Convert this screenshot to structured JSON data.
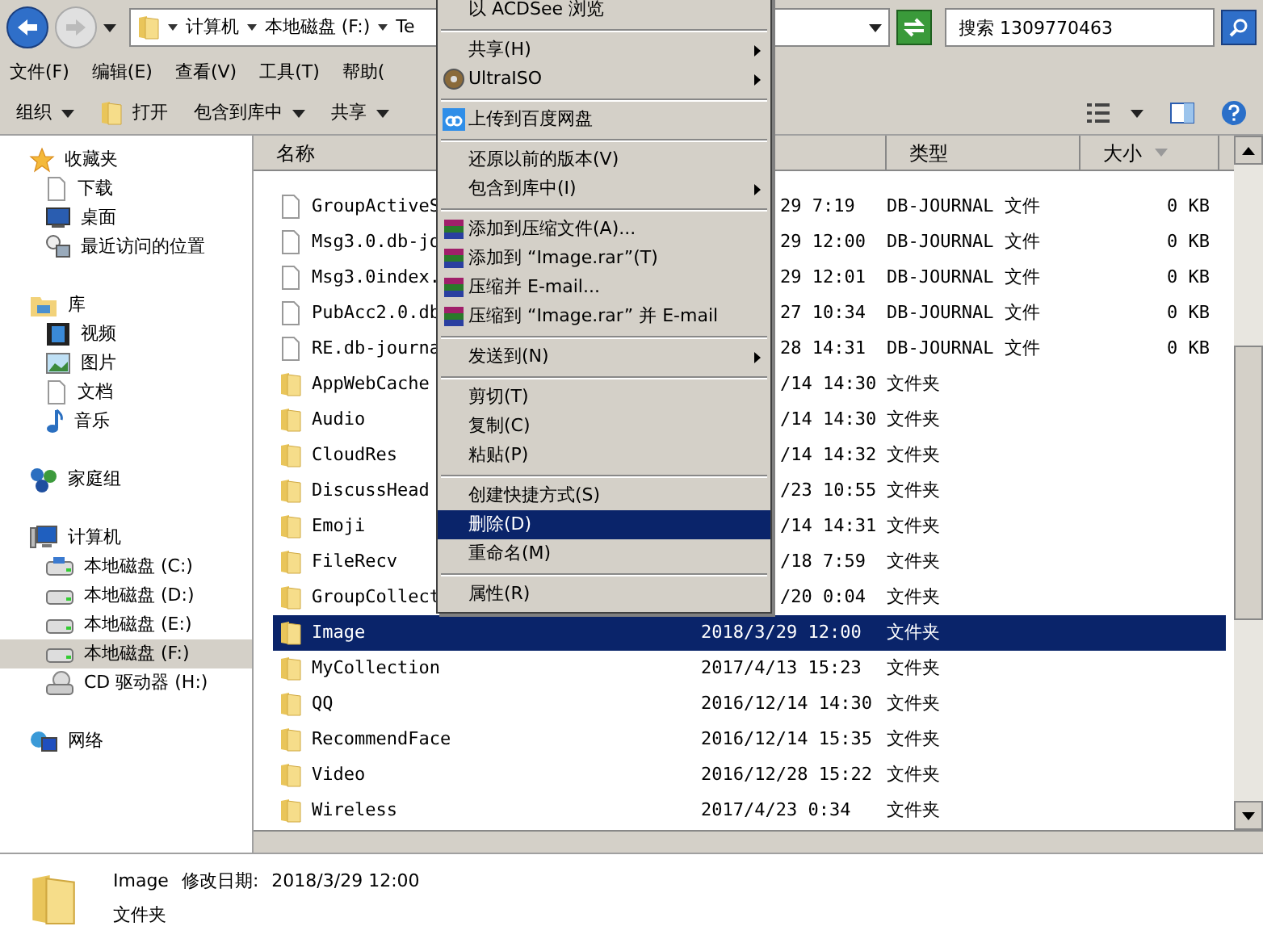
{
  "nav": {
    "address": [
      {
        "label": "计算机"
      },
      {
        "label": "本地磁盘 (F:)"
      },
      {
        "label": "Te"
      }
    ],
    "search": {
      "placeholder": "搜索 1309770463"
    }
  },
  "menu_bar": [
    "文件(F)",
    "编辑(E)",
    "查看(V)",
    "工具(T)",
    "帮助("
  ],
  "toolbar": [
    {
      "label": "组织",
      "kind": "plain",
      "dropdown": true
    },
    {
      "label": "打开",
      "kind": "icon",
      "dropdown": false
    },
    {
      "label": "包含到库中",
      "kind": "plain",
      "dropdown": true
    },
    {
      "label": "共享",
      "kind": "plain",
      "dropdown": true
    }
  ],
  "sidebar": [
    {
      "label": "收藏夹",
      "kind": "favorites",
      "selected": false,
      "children": [
        {
          "label": "下载",
          "kind": "download",
          "selected": false
        },
        {
          "label": "桌面",
          "kind": "desktop",
          "selected": false
        },
        {
          "label": "最近访问的位置",
          "kind": "recent",
          "selected": false
        }
      ]
    },
    {
      "label": "库",
      "kind": "library",
      "selected": false,
      "children": [
        {
          "label": "视频",
          "kind": "video",
          "selected": false
        },
        {
          "label": "图片",
          "kind": "pictures",
          "selected": false
        },
        {
          "label": "文档",
          "kind": "documents",
          "selected": false
        },
        {
          "label": "音乐",
          "kind": "music",
          "selected": false
        }
      ]
    },
    {
      "label": "家庭组",
      "kind": "homegroup",
      "selected": false
    },
    {
      "label": "计算机",
      "kind": "computer",
      "selected": false,
      "children": [
        {
          "label": "本地磁盘 (C:)",
          "kind": "system_drive",
          "selected": false
        },
        {
          "label": "本地磁盘 (D:)",
          "kind": "drive",
          "selected": false
        },
        {
          "label": "本地磁盘 (E:)",
          "kind": "drive",
          "selected": false
        },
        {
          "label": "本地磁盘 (F:)",
          "kind": "drive",
          "selected": true
        },
        {
          "label": "CD 驱动器 (H:)",
          "kind": "cd_drive",
          "selected": false
        }
      ]
    },
    {
      "label": "网络",
      "kind": "network",
      "selected": false
    }
  ],
  "columns": [
    {
      "label": "名称",
      "sorted": false
    },
    {
      "label": "类型",
      "sorted": false
    },
    {
      "label": "大小",
      "sorted": true
    }
  ],
  "files": [
    {
      "name": "GroupActiveS",
      "date": "29 7:19",
      "type": "DB-JOURNAL 文件",
      "size": "0 KB",
      "kind": "file",
      "selected": false
    },
    {
      "name": "Msg3.0.db-jo",
      "date": "29 12:00",
      "type": "DB-JOURNAL 文件",
      "size": "0 KB",
      "kind": "file",
      "selected": false
    },
    {
      "name": "Msg3.0index.",
      "date": "29 12:01",
      "type": "DB-JOURNAL 文件",
      "size": "0 KB",
      "kind": "file",
      "selected": false
    },
    {
      "name": "PubAcc2.0.db",
      "date": "27 10:34",
      "type": "DB-JOURNAL 文件",
      "size": "0 KB",
      "kind": "file",
      "selected": false
    },
    {
      "name": "RE.db-journa",
      "date": "28 14:31",
      "type": "DB-JOURNAL 文件",
      "size": "0 KB",
      "kind": "file",
      "selected": false
    },
    {
      "name": "AppWebCache",
      "date": "/14 14:30",
      "type": "文件夹",
      "kind": "folder",
      "selected": false
    },
    {
      "name": "Audio",
      "date": "/14 14:30",
      "type": "文件夹",
      "kind": "folder",
      "selected": false
    },
    {
      "name": "CloudRes",
      "date": "/14 14:32",
      "type": "文件夹",
      "kind": "folder",
      "selected": false
    },
    {
      "name": "DiscussHead",
      "date": "/23 10:55",
      "type": "文件夹",
      "kind": "folder",
      "selected": false
    },
    {
      "name": "Emoji",
      "date": "/14 14:31",
      "type": "文件夹",
      "kind": "folder",
      "selected": false
    },
    {
      "name": "FileRecv",
      "date": "/18 7:59",
      "type": "文件夹",
      "kind": "folder",
      "selected": false
    },
    {
      "name": "GroupCollect",
      "date": "/20 0:04",
      "type": "文件夹",
      "kind": "folder",
      "selected": false
    },
    {
      "name": "Image",
      "date": "2018/3/29 12:00",
      "type": "文件夹",
      "kind": "folder",
      "selected": true
    },
    {
      "name": "MyCollection",
      "date": "2017/4/13 15:23",
      "type": "文件夹",
      "kind": "folder",
      "selected": false
    },
    {
      "name": "QQ",
      "date": "2016/12/14 14:30",
      "type": "文件夹",
      "kind": "folder",
      "selected": false
    },
    {
      "name": "RecommendFace",
      "date": "2016/12/14 15:35",
      "type": "文件夹",
      "kind": "folder",
      "selected": false
    },
    {
      "name": "Video",
      "date": "2016/12/28 15:22",
      "type": "文件夹",
      "kind": "folder",
      "selected": false
    },
    {
      "name": "Wireless",
      "date": "2017/4/23 0:34",
      "type": "文件夹",
      "kind": "folder",
      "selected": false
    }
  ],
  "context_menu": [
    [
      {
        "label": "以 ACDSee 浏览",
        "kind": "plain",
        "submenu": false,
        "selected": false
      }
    ],
    [
      {
        "label": "共享(H)",
        "kind": "plain",
        "submenu": true,
        "selected": false
      },
      {
        "label": "UltraISO",
        "kind": "disc",
        "submenu": true,
        "selected": false
      }
    ],
    [
      {
        "label": "上传到百度网盘",
        "kind": "cloud",
        "submenu": false,
        "selected": false
      }
    ],
    [
      {
        "label": "还原以前的版本(V)",
        "kind": "plain",
        "submenu": false,
        "selected": false
      },
      {
        "label": "包含到库中(I)",
        "kind": "plain",
        "submenu": true,
        "selected": false
      }
    ],
    [
      {
        "label": "添加到压缩文件(A)...",
        "kind": "archive",
        "submenu": false,
        "selected": false
      },
      {
        "label": "添加到 “Image.rar”(T)",
        "kind": "archive",
        "submenu": false,
        "selected": false
      },
      {
        "label": "压缩并 E-mail...",
        "kind": "archive",
        "submenu": false,
        "selected": false
      },
      {
        "label": "压缩到 “Image.rar” 并 E-mail",
        "kind": "archive",
        "submenu": false,
        "selected": false
      }
    ],
    [
      {
        "label": "发送到(N)",
        "kind": "plain",
        "submenu": true,
        "selected": false
      }
    ],
    [
      {
        "label": "剪切(T)",
        "kind": "plain",
        "submenu": false,
        "selected": false
      },
      {
        "label": "复制(C)",
        "kind": "plain",
        "submenu": false,
        "selected": false
      },
      {
        "label": "粘贴(P)",
        "kind": "plain",
        "submenu": false,
        "selected": false
      }
    ],
    [
      {
        "label": "创建快捷方式(S)",
        "kind": "plain",
        "submenu": false,
        "selected": false
      },
      {
        "label": "删除(D)",
        "kind": "plain",
        "submenu": false,
        "selected": true
      },
      {
        "label": "重命名(M)",
        "kind": "plain",
        "submenu": false,
        "selected": false
      }
    ],
    [
      {
        "label": "属性(R)",
        "kind": "plain",
        "submenu": false,
        "selected": false
      }
    ]
  ],
  "details": {
    "name": "Image",
    "modified_label": "修改日期:",
    "modified": "2018/3/29 12:00",
    "type": "文件夹"
  }
}
